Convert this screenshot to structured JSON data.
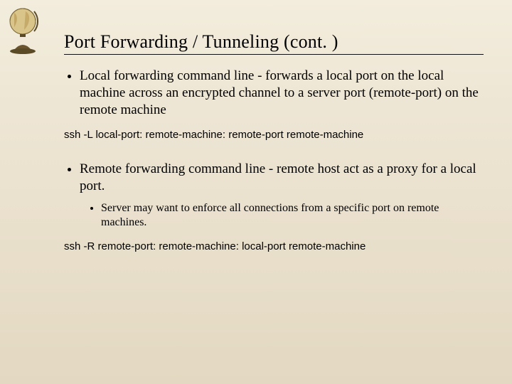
{
  "title": "Port Forwarding / Tunneling (cont. )",
  "bullets": {
    "local_desc": "Local forwarding command line - forwards a local port on the local machine across an encrypted channel to a server port (remote-port) on the remote machine",
    "remote_desc": "Remote forwarding command line - remote host act as a proxy for a local port.",
    "remote_sub": "Server may want to enforce all connections from a specific port on remote machines."
  },
  "commands": {
    "local": "ssh -L local-port: remote-machine: remote-port remote-machine",
    "remote": "ssh -R remote-port: remote-machine: local-port remote-machine"
  }
}
